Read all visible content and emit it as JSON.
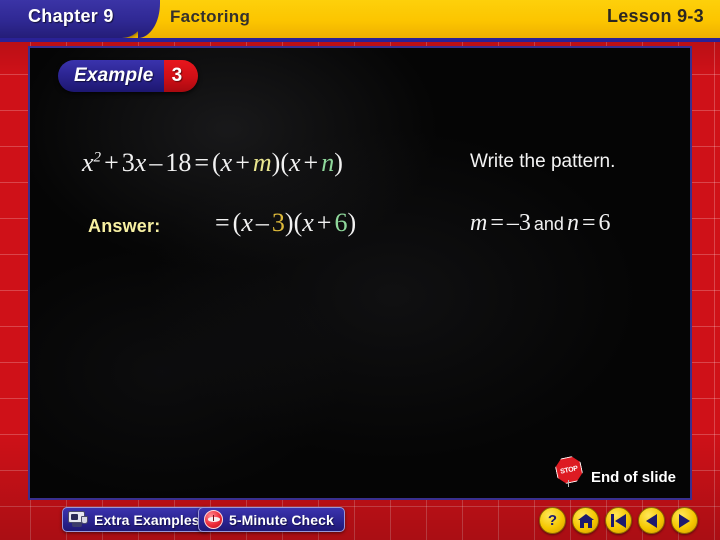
{
  "header": {
    "chapter": "Chapter 9",
    "topic": "Factoring",
    "lesson": "Lesson 9-3"
  },
  "slide": {
    "badge": {
      "label": "Example",
      "number": "3"
    },
    "equation_main": {
      "lhs_x": "x",
      "lhs_exp": "2",
      "plus": "+",
      "term_3x": "3",
      "term_x": "x",
      "minus": "–",
      "term_18": "18",
      "equals": "=",
      "open1": "(",
      "fx1": "x",
      "plus1": "+",
      "m": "m",
      "close1": ")",
      "open2": "(",
      "fx2": "x",
      "plus2": "+",
      "n": "n",
      "close2": ")"
    },
    "answer_label": "Answer:",
    "equation_answer": {
      "equals": "=",
      "open1": "(",
      "x1": "x",
      "minus": "–",
      "three": "3",
      "close1": ")",
      "open2": "(",
      "x2": "x",
      "plus": "+",
      "six": "6",
      "close2": ")"
    },
    "note_pattern": "Write the pattern.",
    "note_values": {
      "m": "m",
      "eq1": "=",
      "neg3": "–3",
      "and": "and",
      "n": "n",
      "eq2": "=",
      "six": "6"
    },
    "end_of_slide": {
      "sign_text": "STOP",
      "label": "End of slide"
    }
  },
  "bottom_bar": {
    "extra_examples": "Extra Examples",
    "five_minute_check": "5-Minute Check",
    "nav": {
      "help": "?",
      "home": "home",
      "rewind": "rewind",
      "previous": "previous",
      "next": "next"
    }
  },
  "colors": {
    "frame_red": "#cf1118",
    "banner_yellow": "#fcc500",
    "banner_blue": "#2f2893",
    "badge_red": "#d00f16",
    "answer_yellow": "#f7f0a2",
    "m_yellow": "#e9e58f",
    "n_green": "#8fd89b",
    "gold": "#ddb93a",
    "nav_yellow": "#f5c700",
    "slide_black": "#050505"
  }
}
